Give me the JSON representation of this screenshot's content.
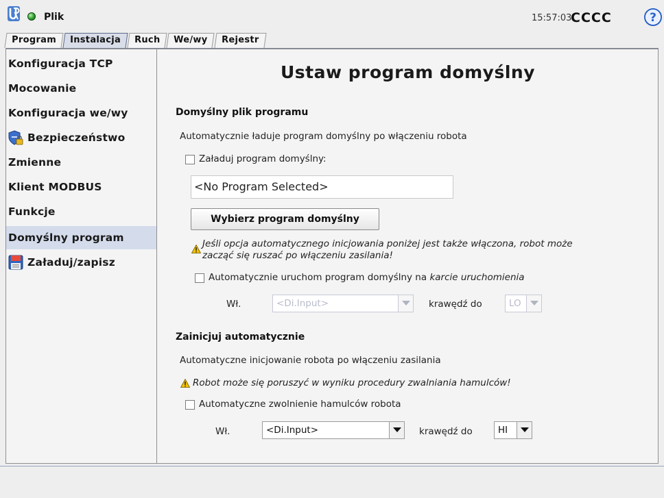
{
  "topbar": {
    "file_menu": "Plik",
    "clock": "15:57:03",
    "robot_name": "CCCC"
  },
  "tabs": [
    {
      "label": "Program"
    },
    {
      "label": "Instalacja"
    },
    {
      "label": "Ruch"
    },
    {
      "label": "We/wy"
    },
    {
      "label": "Rejestr"
    }
  ],
  "sidebar": {
    "items": [
      {
        "label": "Konfiguracja TCP"
      },
      {
        "label": "Mocowanie"
      },
      {
        "label": "Konfiguracja we/wy"
      },
      {
        "label": "Bezpieczeństwo",
        "icon": "shield-lock-icon"
      },
      {
        "label": "Zmienne"
      },
      {
        "label": "Klient MODBUS"
      },
      {
        "label": "Funkcje"
      },
      {
        "label": "Domyślny program",
        "selected": true
      },
      {
        "label": "Załaduj/zapisz",
        "icon": "floppy-disk-icon"
      }
    ]
  },
  "main": {
    "title": "Ustaw program domyślny",
    "default_file": {
      "heading": "Domyślny plik programu",
      "description": "Automatycznie ładuje program domyślny po włączeniu robota",
      "load_checkbox_label": "Załaduj program domyślny:",
      "load_checked": false,
      "program_field": "<No Program Selected>",
      "select_button": "Wybierz program domyślny",
      "warning_line1": "Jeśli opcja automatycznego inicjowania poniżej jest także włączona, robot może",
      "warning_line2": "zacząć się ruszać po włączeniu zasilania!",
      "autorun_label_prefix": "Automatycznie uruchom program domyślny na ",
      "autorun_label_italic": "karcie uruchomienia",
      "autorun_checked": false,
      "input_label": "Wł.",
      "input_value": "<Di.Input>",
      "edge_label": "krawędź do",
      "edge_value": "LO"
    },
    "auto_init": {
      "heading": "Zainicjuj automatycznie",
      "description": "Automatyczne inicjowanie robota po włączeniu zasilania",
      "warning": "Robot może się poruszyć w wyniku procedury zwalniania hamulców!",
      "brake_checkbox_label": "Automatyczne zwolnienie hamulców robota",
      "brake_checked": false,
      "input_label": "Wł.",
      "input_value": "<Di.Input>",
      "edge_label": "krawędź do",
      "edge_value": "HI"
    }
  },
  "colors": {
    "status_ok": "#2c9d2c",
    "selected_bg": "#d4dcec",
    "help_icon": "#2a62c9",
    "warning": "#f2c200"
  }
}
